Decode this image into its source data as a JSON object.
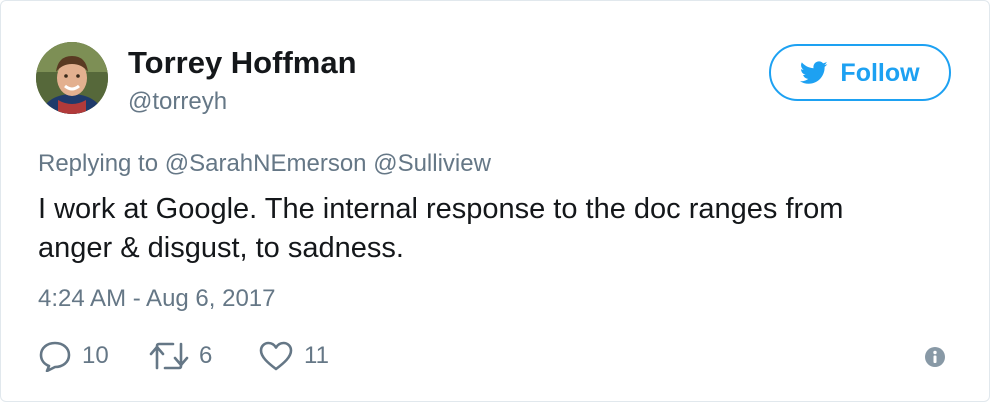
{
  "user": {
    "display_name": "Torrey Hoffman",
    "handle": "@torreyh",
    "avatar_icon": "avatar-photo"
  },
  "follow_button": {
    "label": "Follow",
    "icon": "twitter-bird-icon",
    "color": "#1da1f2"
  },
  "reply_context": {
    "prefix": "Replying to",
    "mentions": [
      "@SarahNEmerson",
      "@Sulliview"
    ]
  },
  "tweet": {
    "text_lines": [
      "I work at Google. The internal response to the doc ranges from",
      "anger & disgust, to sadness."
    ],
    "timestamp": "4:24 AM - Aug 6, 2017"
  },
  "actions": {
    "replies": {
      "icon": "reply-icon",
      "count": "10"
    },
    "retweets": {
      "icon": "retweet-icon",
      "count": "6"
    },
    "likes": {
      "icon": "heart-icon",
      "count": "11"
    },
    "info": {
      "icon": "info-icon"
    }
  },
  "colors": {
    "text": "#14171a",
    "secondary": "#657786",
    "accent": "#1da1f2",
    "border": "#e1e8ed"
  }
}
